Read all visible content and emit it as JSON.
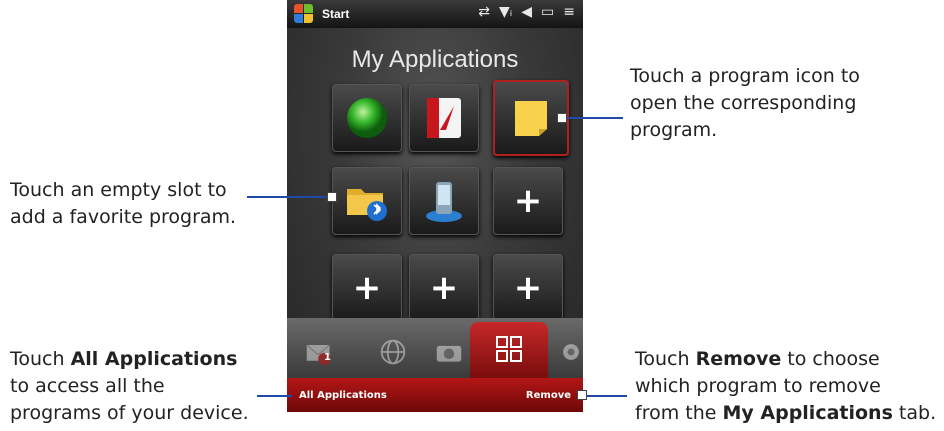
{
  "phone": {
    "status_bar": {
      "start_label": "Start",
      "icons": [
        "data-sync-icon",
        "signal-icon",
        "speaker-icon",
        "battery-icon",
        "menu-icon"
      ]
    },
    "title": "My Applications",
    "grid": [
      {
        "icon": "green-ball-icon"
      },
      {
        "icon": "pdf-reader-icon"
      },
      {
        "icon": "sticky-note-icon",
        "selected": true
      },
      {
        "icon": "bluetooth-folder-icon"
      },
      {
        "icon": "phone-device-icon"
      },
      {
        "plus": "+"
      },
      {
        "plus": "+"
      },
      {
        "plus": "+"
      },
      {
        "plus": "+"
      }
    ],
    "tabs": [
      "messaging-tab",
      "internet-tab",
      "camera-tab",
      "applications-tab",
      "settings-tab"
    ],
    "notification_badge": "1",
    "softkey_left": "All Applications",
    "softkey_right": "Remove"
  },
  "callouts": {
    "program_icon": [
      "Touch a program icon to",
      "open the corresponding",
      "program."
    ],
    "empty_slot": [
      "Touch an empty slot to",
      "add a favorite program."
    ],
    "all_apps": {
      "l1_pre": "Touch ",
      "l1_bold": "All Applications",
      "l2": "to access all the",
      "l3": "programs of your device."
    },
    "remove": {
      "l1_pre": "Touch ",
      "l1_bold": "Remove",
      "l1_post": " to choose",
      "l2": "which program to remove",
      "l3_pre": "from the ",
      "l3_bold": "My Applications",
      "l3_post": " tab."
    }
  },
  "colors": {
    "accent": "#b31616",
    "leader": "#1f4aa8"
  }
}
